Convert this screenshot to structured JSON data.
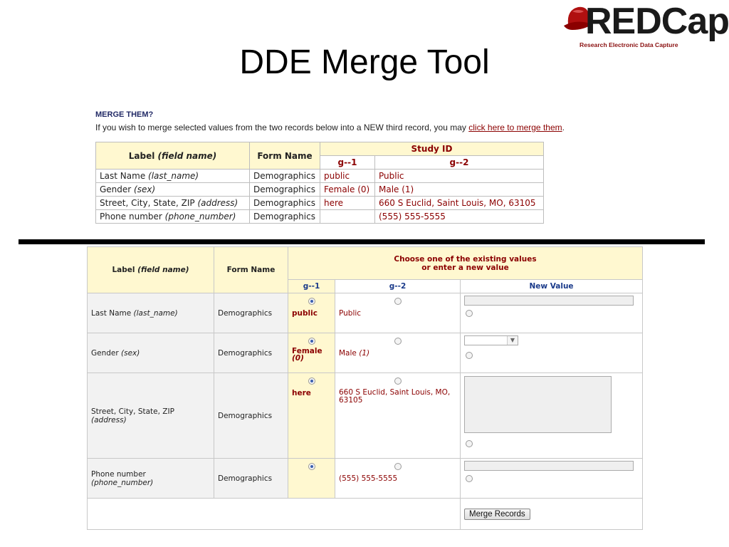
{
  "logo": {
    "brand": "REDCap",
    "tagline": "Research Electronic Data Capture"
  },
  "page_title": "DDE Merge Tool",
  "merge_section": {
    "heading": "MERGE THEM?",
    "description_before": "If you wish to merge selected values from the two records below into a NEW third record, you may ",
    "link_text": "click here to merge them",
    "description_after": "."
  },
  "compare_table": {
    "headers": {
      "label": "Label",
      "field_name": "(field name)",
      "form": "Form Name",
      "study_id": "Study ID",
      "record1": "g--1",
      "record2": "g--2"
    },
    "rows": [
      {
        "label": "Last Name ",
        "field": "(last_name)",
        "form": "Demographics",
        "v1": "public",
        "v2": "Public"
      },
      {
        "label": "Gender ",
        "field": "(sex)",
        "form": "Demographics",
        "v1": "Female (0)",
        "v2": "Male (1)"
      },
      {
        "label": "Street, City, State, ZIP ",
        "field": "(address)",
        "form": "Demographics",
        "v1": "here",
        "v2": "660 S Euclid, Saint Louis, MO, 63105"
      },
      {
        "label": "Phone number ",
        "field": "(phone_number)",
        "form": "Demographics",
        "v1": "",
        "v2": "(555) 555-5555"
      }
    ]
  },
  "merge_table": {
    "headers": {
      "label": "Label",
      "field_name": "(field name)",
      "form": "Form Name",
      "choose_line1": "Choose one of the existing values",
      "choose_line2": "or enter a new value",
      "record1": "g--1",
      "record2": "g--2",
      "new_value": "New Value"
    },
    "rows": [
      {
        "label": "Last Name ",
        "field": "(last_name)",
        "form": "Demographics",
        "v1": "public",
        "v1_unit": "",
        "v2": "Public",
        "v2_unit": ""
      },
      {
        "label": "Gender ",
        "field": "(sex)",
        "form": "Demographics",
        "v1": "Female",
        "v1_unit": "(0)",
        "v2": "Male ",
        "v2_unit": "(1)"
      },
      {
        "label": "Street, City, State, ZIP ",
        "field": "(address)",
        "form": "Demographics",
        "v1": "here",
        "v1_unit": "",
        "v2": "660 S Euclid, Saint Louis, MO, 63105",
        "v2_unit": ""
      },
      {
        "label": "Phone number ",
        "field": "(phone_number)",
        "form": "Demographics",
        "v1": "",
        "v1_unit": "",
        "v2": "(555) 555-5555",
        "v2_unit": ""
      }
    ],
    "merge_button": "Merge Records"
  },
  "colors": {
    "header_bg": "#fff8d0",
    "accent_red": "#8b0000",
    "link_red": "#8b0000",
    "heading_blue": "#222a66"
  }
}
